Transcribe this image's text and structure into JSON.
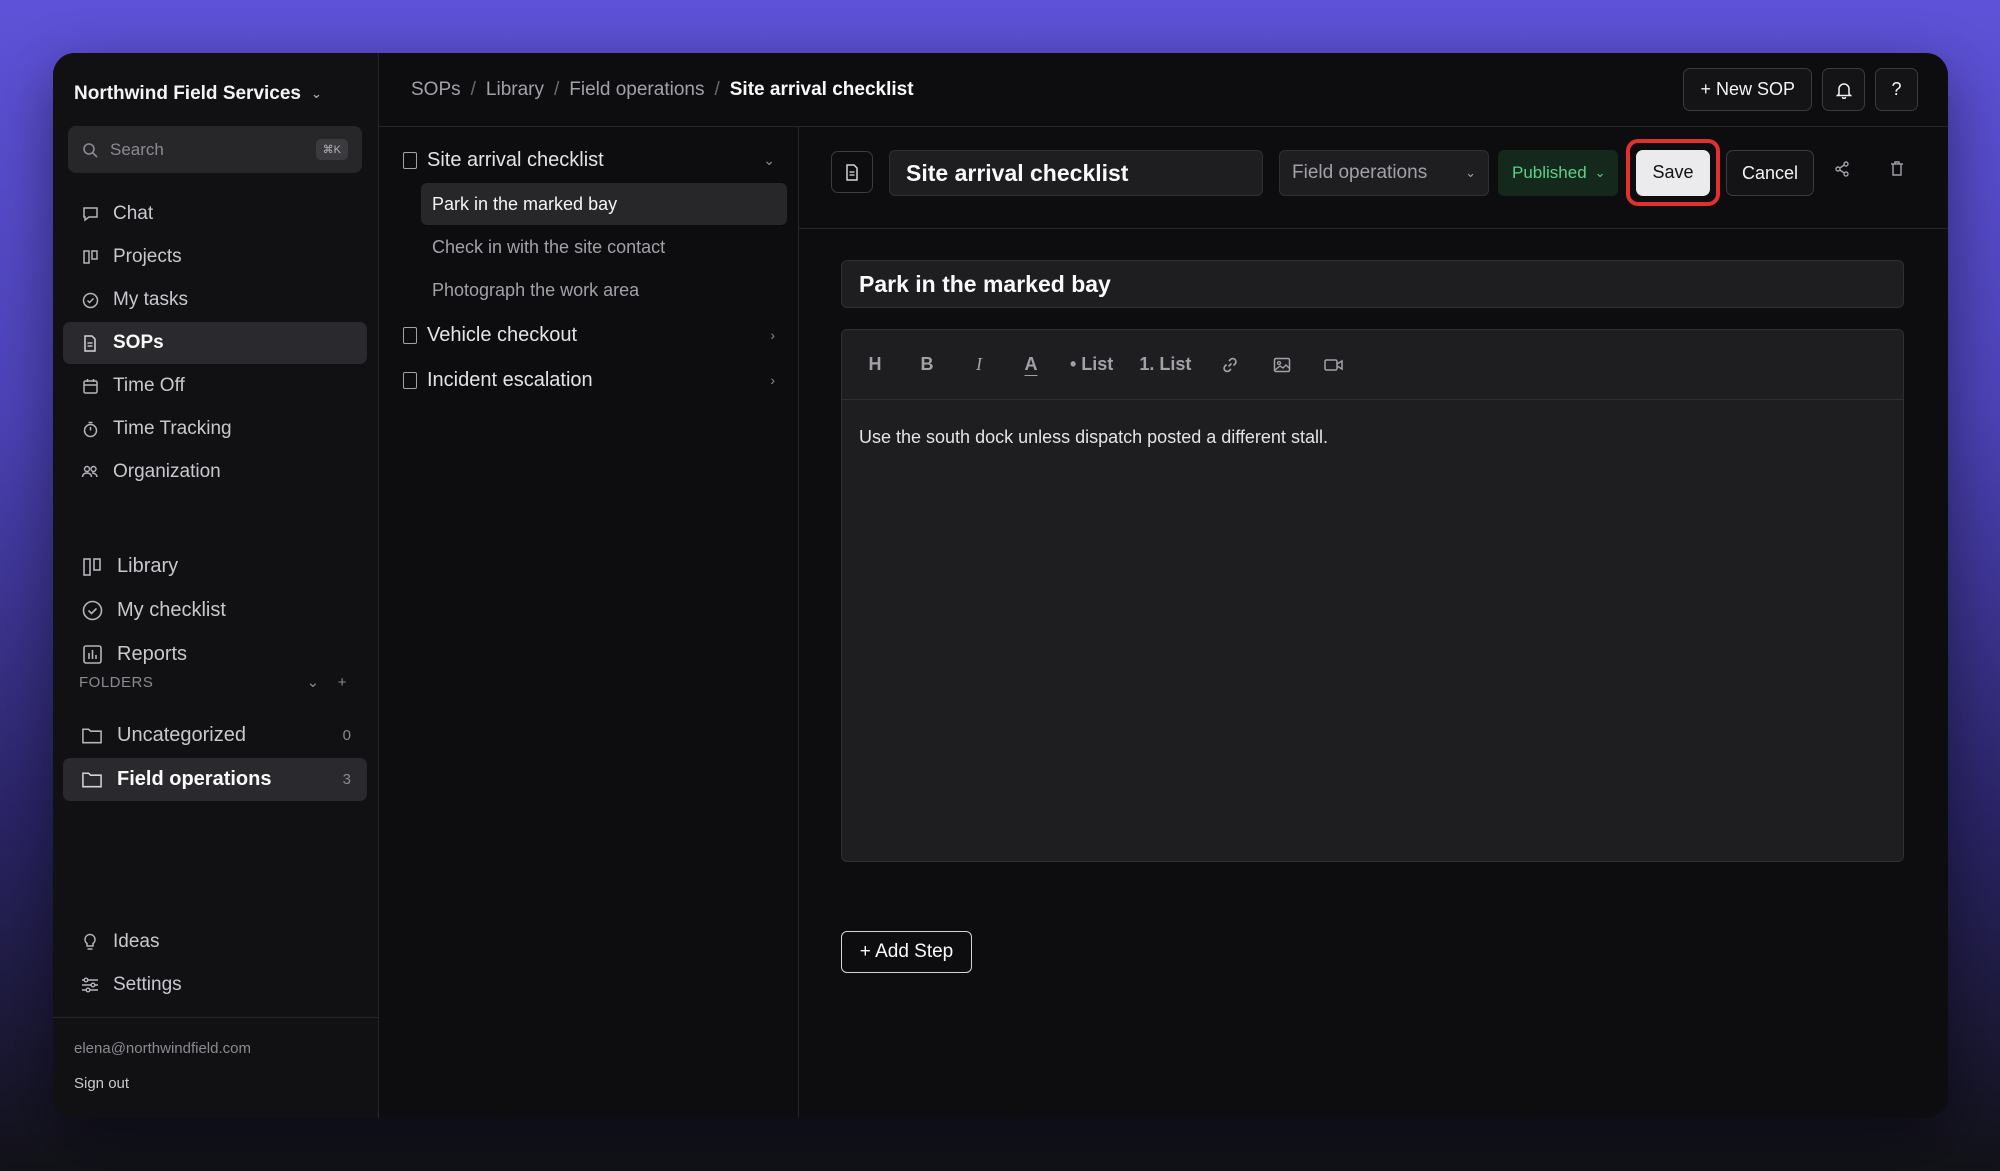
{
  "sidebar": {
    "org_name": "Northwind Field Services",
    "search_placeholder": "Search",
    "search_shortcut": "⌘K",
    "nav": [
      {
        "label": "Chat",
        "icon": "chat-icon"
      },
      {
        "label": "Projects",
        "icon": "columns-icon"
      },
      {
        "label": "My tasks",
        "icon": "check-circle-icon"
      },
      {
        "label": "SOPs",
        "icon": "document-icon",
        "active": true
      },
      {
        "label": "Time Off",
        "icon": "calendar-icon"
      },
      {
        "label": "Time Tracking",
        "icon": "stopwatch-icon"
      },
      {
        "label": "Organization",
        "icon": "users-icon"
      }
    ],
    "nav2": [
      {
        "label": "Library",
        "icon": "columns-icon"
      },
      {
        "label": "My checklist",
        "icon": "check-circle-icon"
      },
      {
        "label": "Reports",
        "icon": "chart-icon"
      }
    ],
    "folders_label": "FOLDERS",
    "folders": [
      {
        "label": "Uncategorized",
        "count": "0"
      },
      {
        "label": "Field operations",
        "count": "3",
        "active": true
      }
    ],
    "bottom": [
      {
        "label": "Ideas",
        "icon": "lightbulb-icon"
      },
      {
        "label": "Settings",
        "icon": "sliders-icon"
      }
    ],
    "email": "elena@northwindfield.com",
    "sign_out": "Sign out"
  },
  "breadcrumb": [
    "SOPs",
    "Library",
    "Field operations",
    "Site arrival checklist"
  ],
  "top_actions": {
    "new_sop": "+ New SOP",
    "help": "?"
  },
  "tree": {
    "items": [
      {
        "label": "Site arrival checklist",
        "expanded": true,
        "steps": [
          "Park in the marked bay",
          "Check in with the site contact",
          "Photograph the work area"
        ]
      },
      {
        "label": "Vehicle checkout"
      },
      {
        "label": "Incident escalation"
      }
    ],
    "active_step": "Park in the marked bay"
  },
  "editor": {
    "title": "Site arrival checklist",
    "folder": "Field operations",
    "status": "Published",
    "save": "Save",
    "cancel": "Cancel",
    "step_title": "Park in the marked bay",
    "toolbar": [
      "H",
      "B",
      "I",
      "A",
      "• List",
      "1. List"
    ],
    "body": "Use the south dock unless dispatch posted a different stall.",
    "add_step": "+ Add Step"
  },
  "colors": {
    "accent_save_highlight": "#e0312e",
    "published": "#5fcf8a"
  }
}
